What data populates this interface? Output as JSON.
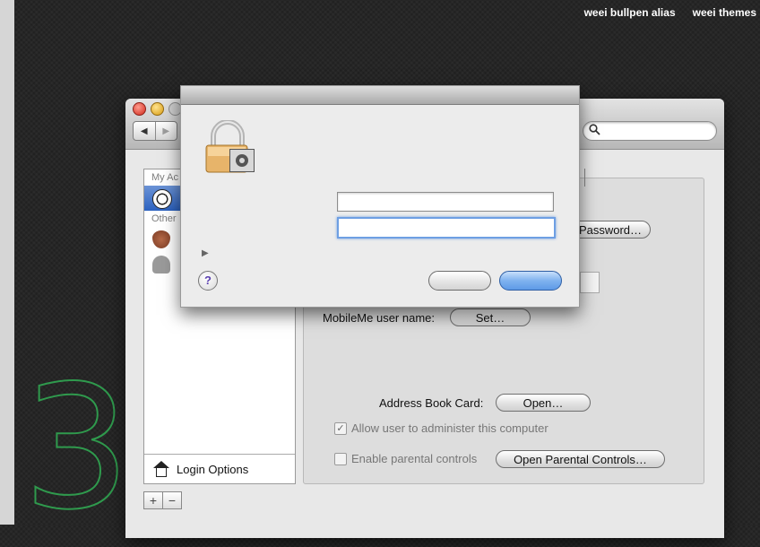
{
  "header": {
    "links": [
      "weei bullpen alias",
      "weei themes"
    ]
  },
  "background": {
    "decor_digit": "3",
    "accent_color": "#2f9a4d"
  },
  "window": {
    "nav": {
      "back": "◀",
      "forward": "▶"
    },
    "search": {
      "placeholder": ""
    }
  },
  "sidebar": {
    "section_my_account": "My Ac",
    "section_other": "Other",
    "login_options": "Login Options",
    "add": "+",
    "remove": "−"
  },
  "panel": {
    "change_password_label": "Password…",
    "mobileme_label": "MobileMe user name:",
    "set_button": "Set…",
    "address_book_label": "Address Book Card:",
    "open_button": "Open…",
    "allow_admin_label": "Allow user to administer this computer",
    "allow_admin_checked": true,
    "parental_label": "Enable parental controls",
    "parental_checked": false,
    "open_parental_button": "Open Parental Controls…"
  },
  "auth_sheet": {
    "name_value": "",
    "password_value": "",
    "help": "?",
    "disclosure": "▶",
    "icons": [
      "lock-icon",
      "preferences-icon"
    ]
  },
  "colors": {
    "selection": "#2c62c0",
    "default_button": "#6ea6ec"
  }
}
